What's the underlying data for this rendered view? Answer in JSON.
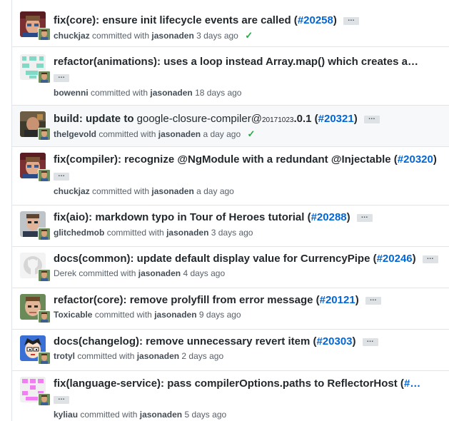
{
  "commits": [
    {
      "title": "fix(core): ensure init lifecycle events are called (",
      "pr": "#20258",
      "title_end": ")",
      "author": "chuckjaz",
      "committed_with": "committed with",
      "committer": "jasonaden",
      "time": "3 days ago",
      "status": "✓",
      "avatar": "avatar-chuckjaz"
    },
    {
      "title": "refactor(animations): uses a loop instead Array.map() which creates a…",
      "author": "bowenni",
      "committed_with": "committed with",
      "committer": "jasonaden",
      "time": "18 days ago",
      "avatar": "identicon-teal"
    },
    {
      "title": "build: update to ",
      "title_plain": "google-closure-compiler@",
      "title_small": "20171023",
      "title_after": ".0.1 (",
      "pr": "#20321",
      "title_end": ")",
      "author": "thelgevold",
      "committed_with": "committed with",
      "committer": "jasonaden",
      "time": "a day ago",
      "status": "✓",
      "avatar": "avatar-thelgevold"
    },
    {
      "title": "fix(compiler): recognize @NgModule with a redundant @Injectable (",
      "pr": "#20320",
      "title_end": ")",
      "author": "chuckjaz",
      "committed_with": "committed with",
      "committer": "jasonaden",
      "time": "a day ago",
      "avatar": "avatar-chuckjaz"
    },
    {
      "title": "fix(aio): markdown typo in Tour of Heroes tutorial (",
      "pr": "#20288",
      "title_end": ")",
      "author": "glitchedmob",
      "committed_with": "committed with",
      "committer": "jasonaden",
      "time": "3 days ago",
      "avatar": "avatar-glitchedmob"
    },
    {
      "title": "docs(common): update default display value for CurrencyPipe (",
      "pr": "#20246",
      "title_end": ")",
      "author": "Derek",
      "committed_with": "committed with",
      "committer": "jasonaden",
      "time": "4 days ago",
      "avatar": "avatar-github-default"
    },
    {
      "title": "refactor(core): remove prolyfill from error message (",
      "pr": "#20121",
      "title_end": ")",
      "author": "Toxicable",
      "committed_with": "committed with",
      "committer": "jasonaden",
      "time": "9 days ago",
      "avatar": "avatar-toxicable"
    },
    {
      "title": "docs(changelog): remove unnecessary revert item (",
      "pr": "#20303",
      "title_end": ")",
      "author": "trotyl",
      "committed_with": "committed with",
      "committer": "jasonaden",
      "time": "2 days ago",
      "avatar": "avatar-trotyl"
    },
    {
      "title": "fix(language-service): pass compilerOptions.paths to ReflectorHost (",
      "pr": "#…",
      "author": "kyliau",
      "committed_with": "committed with",
      "committer": "jasonaden",
      "time": "5 days ago",
      "avatar": "identicon-pink"
    }
  ],
  "ellipsis_label": "…",
  "colors": {
    "link": "#0366d6",
    "success": "#28a745",
    "muted": "#586069",
    "border": "#e1e4e8",
    "highlight_row": "#f6f8fa"
  }
}
